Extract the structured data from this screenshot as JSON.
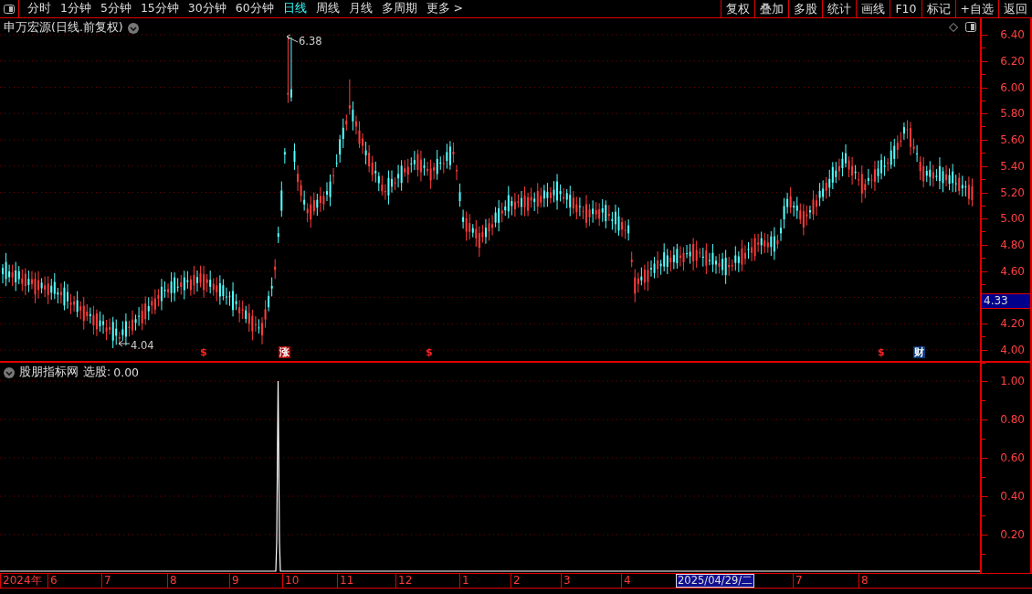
{
  "toolbar": {
    "periods": [
      {
        "label": "分时",
        "selected": false
      },
      {
        "label": "1分钟",
        "selected": false
      },
      {
        "label": "5分钟",
        "selected": false
      },
      {
        "label": "15分钟",
        "selected": false
      },
      {
        "label": "30分钟",
        "selected": false
      },
      {
        "label": "60分钟",
        "selected": false
      },
      {
        "label": "日线",
        "selected": true
      },
      {
        "label": "周线",
        "selected": false
      },
      {
        "label": "月线",
        "selected": false
      },
      {
        "label": "多周期",
        "selected": false
      },
      {
        "label": "更多 >",
        "selected": false
      }
    ],
    "actions": [
      "复权",
      "叠加",
      "多股",
      "统计",
      "画线",
      "F10",
      "标记",
      "+自选",
      "返回"
    ]
  },
  "main_chart": {
    "title": "申万宏源(日线.前复权)",
    "y_ticks": [
      "6.40",
      "6.20",
      "6.00",
      "5.80",
      "5.60",
      "5.40",
      "5.20",
      "5.00",
      "4.80",
      "4.60",
      "4.20",
      "4.00"
    ],
    "high_label": "6.38",
    "low_label": "4.04",
    "current_price": "4.33",
    "markers": [
      {
        "kind": "dollar",
        "text": "$"
      },
      {
        "kind": "rise",
        "text": "涨"
      },
      {
        "kind": "dollar",
        "text": "$"
      },
      {
        "kind": "dollar",
        "text": "$"
      },
      {
        "kind": "finance",
        "text": "财"
      }
    ]
  },
  "indicator": {
    "title": "股朋指标网",
    "reading_label": "选股:",
    "reading": "0.00",
    "y_ticks": [
      "1.00",
      "0.80",
      "0.60",
      "0.40",
      "0.20"
    ]
  },
  "date_axis": {
    "labels": [
      "2024年",
      "6",
      "7",
      "8",
      "9",
      "10",
      "11",
      "12",
      "1",
      "2",
      "3",
      "4",
      "7",
      "8"
    ],
    "cursor_date": "2025/04/29/二"
  }
}
